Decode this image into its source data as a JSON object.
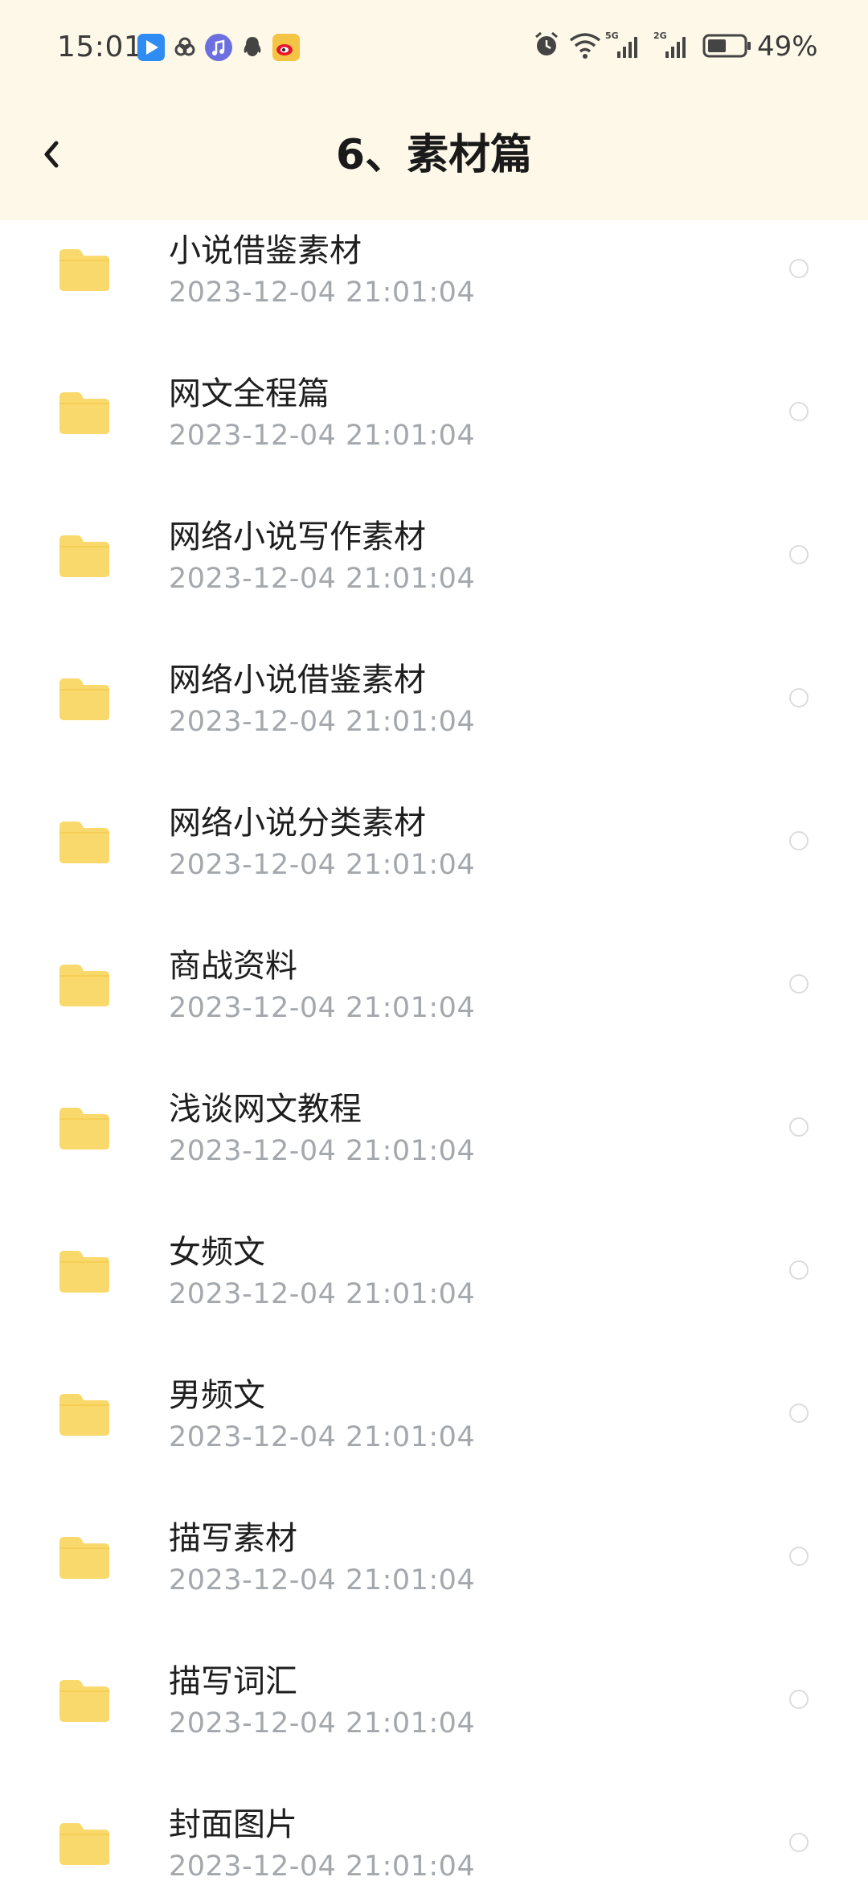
{
  "status_bar": {
    "time": "15:01",
    "battery_percent": "49%",
    "network_1": "5G",
    "network_2": "2G",
    "icons": [
      "play-store-icon",
      "link-app-icon",
      "music-app-icon",
      "qq-icon",
      "weibo-icon",
      "alarm-icon",
      "wifi-icon",
      "signal-icon",
      "battery-icon"
    ]
  },
  "header": {
    "title": "6、素材篇"
  },
  "folders": [
    {
      "name": "小说借鉴素材",
      "date": "2023-12-04  21:01:04"
    },
    {
      "name": "网文全程篇",
      "date": "2023-12-04  21:01:04"
    },
    {
      "name": "网络小说写作素材",
      "date": "2023-12-04  21:01:04"
    },
    {
      "name": "网络小说借鉴素材",
      "date": "2023-12-04  21:01:04"
    },
    {
      "name": "网络小说分类素材",
      "date": "2023-12-04  21:01:04"
    },
    {
      "name": "商战资料",
      "date": "2023-12-04  21:01:04"
    },
    {
      "name": "浅谈网文教程",
      "date": "2023-12-04  21:01:04"
    },
    {
      "name": "女频文",
      "date": "2023-12-04  21:01:04"
    },
    {
      "name": "男频文",
      "date": "2023-12-04  21:01:04"
    },
    {
      "name": "描写素材",
      "date": "2023-12-04  21:01:04"
    },
    {
      "name": "描写词汇",
      "date": "2023-12-04  21:01:04"
    },
    {
      "name": "封面图片",
      "date": "2023-12-04  21:01:04"
    }
  ],
  "colors": {
    "header_bg": "#fdf8e8",
    "folder": "#f9d96b",
    "date_text": "#a4a8ad"
  }
}
